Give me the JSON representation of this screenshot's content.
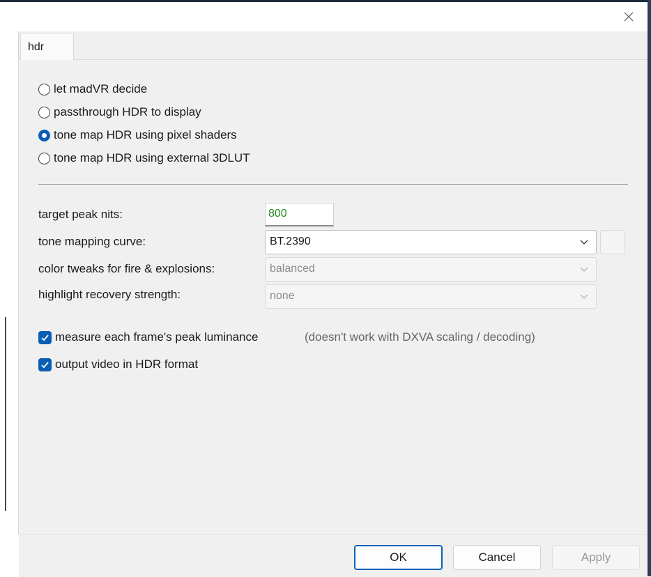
{
  "window": {
    "close_icon": "close-icon"
  },
  "tabs": [
    {
      "label": "hdr"
    }
  ],
  "hdr_mode": {
    "options": [
      {
        "label": "let madVR decide",
        "checked": false
      },
      {
        "label": "passthrough HDR to display",
        "checked": false
      },
      {
        "label": "tone map HDR using pixel shaders",
        "checked": true
      },
      {
        "label": "tone map HDR using external 3DLUT",
        "checked": false
      }
    ]
  },
  "settings": {
    "target_peak_nits": {
      "label": "target peak nits:",
      "value": "800"
    },
    "tone_mapping_curve": {
      "label": "tone mapping curve:",
      "value": "BT.2390"
    },
    "color_tweaks": {
      "label": "color tweaks for fire & explosions:",
      "value": "balanced",
      "enabled": false
    },
    "highlight_recovery": {
      "label": "highlight recovery strength:",
      "value": "none",
      "enabled": false
    }
  },
  "checkboxes": {
    "measure_peak": {
      "label": "measure each frame's peak luminance",
      "checked": true,
      "note": "(doesn't work with DXVA scaling / decoding)"
    },
    "output_hdr": {
      "label": "output video in HDR format",
      "checked": true
    }
  },
  "buttons": {
    "ok": "OK",
    "cancel": "Cancel",
    "apply": "Apply"
  },
  "colors": {
    "accent": "#0a5fb4",
    "nits_text": "#1e8c1e"
  }
}
